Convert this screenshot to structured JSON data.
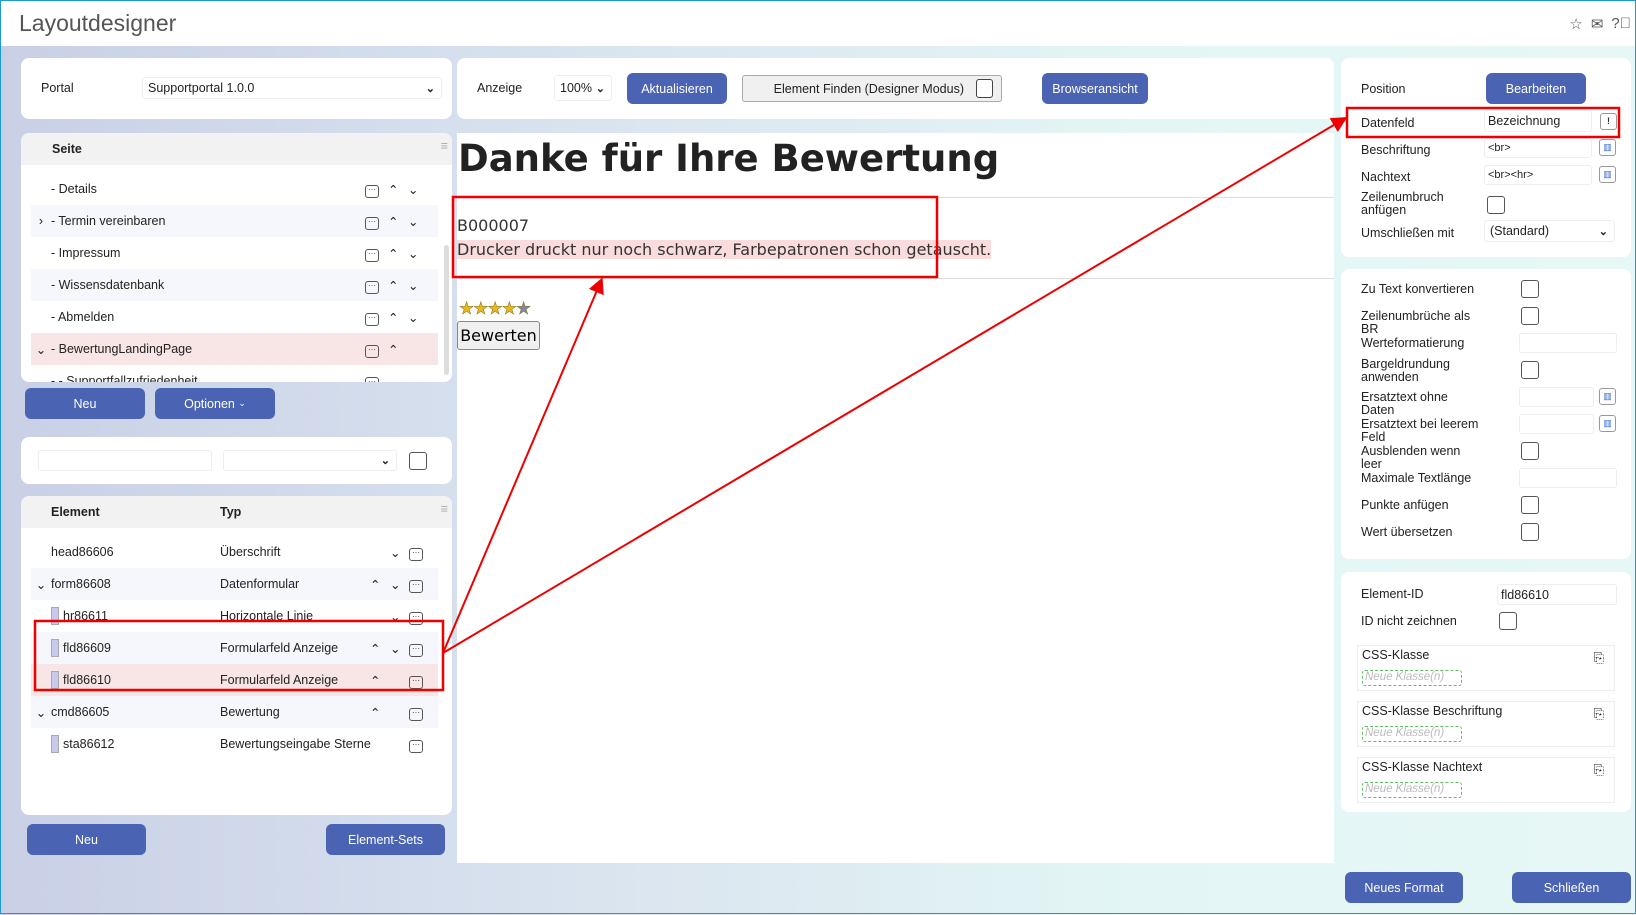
{
  "app": {
    "title": "Layoutdesigner",
    "icons": [
      "star-icon",
      "mail-icon",
      "help-icon"
    ]
  },
  "portal": {
    "label": "Portal",
    "value": "Supportportal 1.0.0"
  },
  "toolbar": {
    "anzeige_label": "Anzeige",
    "zoom": "100%",
    "refresh": "Aktualisieren",
    "find": "Element Finden (Designer Modus)",
    "browser": "Browseransicht"
  },
  "pages": {
    "header": "Seite",
    "items": [
      {
        "label": "- Details",
        "expander": "",
        "up": true,
        "down": true
      },
      {
        "label": "- Termin vereinbaren",
        "expander": "›",
        "up": true,
        "down": true
      },
      {
        "label": "- Impressum",
        "expander": "",
        "up": true,
        "down": true
      },
      {
        "label": "- Wissensdatenbank",
        "expander": "",
        "up": true,
        "down": true
      },
      {
        "label": "- Abmelden",
        "expander": "",
        "up": true,
        "down": true
      },
      {
        "label": "- BewertungLandingPage",
        "expander": "⌄",
        "up": true,
        "down": false,
        "selected": true
      },
      {
        "label": "- - Supportfallzufriedenheit",
        "expander": "",
        "up": false,
        "down": false
      }
    ],
    "new": "Neu",
    "options": "Optionen"
  },
  "elements": {
    "col_element": "Element",
    "col_type": "Typ",
    "rows": [
      {
        "id": "head86606",
        "type": "Überschrift",
        "exp": "",
        "child": false,
        "up": false,
        "down": true
      },
      {
        "id": "form86608",
        "type": "Datenformular",
        "exp": "⌄",
        "child": false,
        "up": true,
        "down": true
      },
      {
        "id": "hr86611",
        "type": "Horizontale Linie",
        "exp": "",
        "child": true,
        "up": false,
        "down": true
      },
      {
        "id": "fld86609",
        "type": "Formularfeld Anzeige",
        "exp": "",
        "child": true,
        "up": true,
        "down": true
      },
      {
        "id": "fld86610",
        "type": "Formularfeld Anzeige",
        "exp": "",
        "child": true,
        "up": true,
        "down": false,
        "selected": true
      },
      {
        "id": "cmd86605",
        "type": "Bewertung",
        "exp": "⌄",
        "child": false,
        "up": true,
        "down": false
      },
      {
        "id": "sta86612",
        "type": "Bewertungseingabe Sterne",
        "exp": "",
        "child": true,
        "up": false,
        "down": false
      }
    ],
    "new": "Neu",
    "sets": "Element-Sets"
  },
  "preview": {
    "heading": "Danke für Ihre Bewertung",
    "case_id": "B000007",
    "description": "Drucker druckt nur noch schwarz, Farbepatronen schon getauscht.",
    "rating": 4,
    "max_rating": 5,
    "rate_button": "Bewerten"
  },
  "props": {
    "position": "Position",
    "edit": "Bearbeiten",
    "datenfeld": "Datenfeld",
    "datenfeld_value": "Bezeichnung",
    "beschriftung": "Beschriftung",
    "beschriftung_value": "<br>",
    "nachtext": "Nachtext",
    "nachtext_value": "<br><hr>",
    "zeilenumbruch": "Zeilenumbruch anfügen",
    "umschliessen": "Umschließen mit",
    "umschliessen_value": "(Standard)"
  },
  "format": {
    "items": [
      "Zu Text konvertieren",
      "Zeilenumbrüche als BR",
      "Werteformatierung",
      "Bargeldrundung anwenden",
      "Ersatztext ohne Daten",
      "Ersatztext bei leerem Feld",
      "Ausblenden wenn leer",
      "Maximale Textlänge",
      "Punkte anfügen",
      "Wert übersetzen"
    ]
  },
  "ids": {
    "element_id": "Element-ID",
    "element_id_value": "fld86610",
    "no_draw": "ID nicht zeichnen",
    "css": "CSS-Klasse",
    "css_label": "CSS-Klasse Beschriftung",
    "css_after": "CSS-Klasse Nachtext",
    "placeholder": "Neue Klasse(n)"
  },
  "footer": {
    "new_format": "Neues Format",
    "close": "Schließen"
  },
  "colors": {
    "accent": "#4a63b3",
    "highlight": "#e00000",
    "selected_row": "#f8e5e5"
  }
}
